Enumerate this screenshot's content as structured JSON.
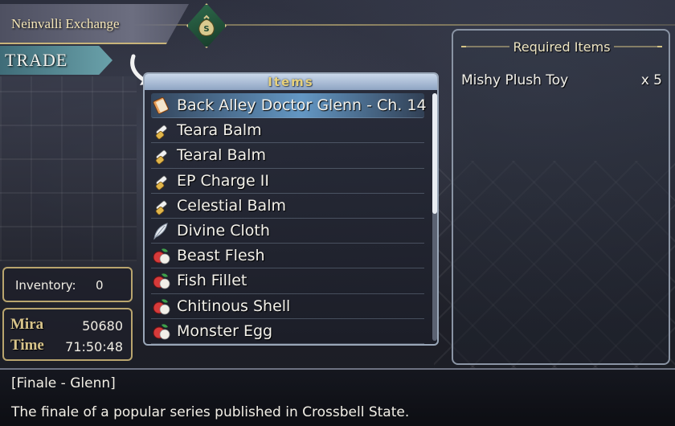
{
  "shop": {
    "name": "Neinvalli Exchange",
    "money_badge_icon": "money-bag-icon",
    "mode": "TRADE"
  },
  "items_panel": {
    "header": "Items",
    "selected_index": 0,
    "items": [
      {
        "name": "Back Alley Doctor Glenn - Ch. 14",
        "icon": "book-icon"
      },
      {
        "name": "Teara Balm",
        "icon": "medicine-vial-icon"
      },
      {
        "name": "Tearal Balm",
        "icon": "medicine-vial-icon"
      },
      {
        "name": "EP Charge II",
        "icon": "medicine-vial-icon"
      },
      {
        "name": "Celestial Balm",
        "icon": "medicine-vial-icon"
      },
      {
        "name": "Divine Cloth",
        "icon": "feather-icon"
      },
      {
        "name": "Beast Flesh",
        "icon": "food-ingredient-icon"
      },
      {
        "name": "Fish Fillet",
        "icon": "food-ingredient-icon"
      },
      {
        "name": "Chitinous Shell",
        "icon": "food-ingredient-icon"
      },
      {
        "name": "Monster Egg",
        "icon": "food-ingredient-icon"
      }
    ]
  },
  "required": {
    "header": "Required Items",
    "rows": [
      {
        "name": "Mishy Plush Toy",
        "qty": "x  5"
      }
    ]
  },
  "status": {
    "inventory_label": "Inventory:",
    "inventory_value": "0",
    "mira_label": "Mira",
    "mira_value": "50680",
    "time_label": "Time",
    "time_value": "71:50:48"
  },
  "description": {
    "title": "[Finale - Glenn]",
    "text": "The finale of a popular series published in Crossbell State."
  },
  "colors": {
    "accent_gold": "#d5c486",
    "selection_blue": "#6eaadc",
    "trade_teal": "#4f8792"
  }
}
